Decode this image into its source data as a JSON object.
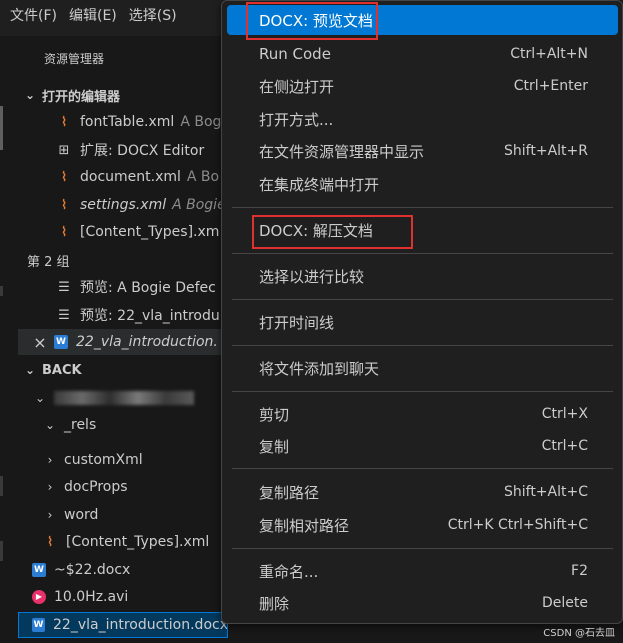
{
  "menubar": {
    "items": [
      "文件(F)",
      "编辑(E)",
      "选择(S)"
    ]
  },
  "sidebar": {
    "title": "资源管理器",
    "open_editors_header": "打开的编辑器",
    "open_editors": [
      {
        "name": "fontTable.xml",
        "desc": "A Bogi",
        "icon": "rss",
        "italic": false
      },
      {
        "name": "扩展: DOCX Editor",
        "desc": "",
        "icon": "ext",
        "italic": false
      },
      {
        "name": "document.xml",
        "desc": "A Bo",
        "icon": "rss",
        "italic": false
      },
      {
        "name": "settings.xml",
        "desc": "A Bogie",
        "icon": "rss",
        "italic": true
      },
      {
        "name": "[Content_Types].xm",
        "desc": "",
        "icon": "rss",
        "italic": false
      }
    ],
    "group2_label": "第 2 组",
    "group2": [
      {
        "name": "预览: A Bogie Defec",
        "icon": "lines"
      },
      {
        "name": "预览: 22_vla_introdu",
        "icon": "lines"
      },
      {
        "name": "22_vla_introduction.",
        "icon": "word",
        "italic": true
      }
    ],
    "folder_header": "BACK",
    "tree": {
      "rels": "_rels",
      "customXml": "customXml",
      "docProps": "docProps",
      "word": "word",
      "content_types": "[Content_Types].xml",
      "tmp_docx": "~$22.docx",
      "video": "10.0Hz.avi",
      "active_docx": "22_vla_introduction.docx"
    }
  },
  "context_menu": {
    "items": [
      {
        "label": "DOCX: 预览文档",
        "shortcut": ""
      },
      {
        "label": "Run Code",
        "shortcut": "Ctrl+Alt+N"
      },
      {
        "label": "在侧边打开",
        "shortcut": "Ctrl+Enter"
      },
      {
        "label": "打开方式...",
        "shortcut": ""
      },
      {
        "label": "在文件资源管理器中显示",
        "shortcut": "Shift+Alt+R"
      },
      {
        "label": "在集成终端中打开",
        "shortcut": ""
      },
      {
        "label": "DOCX: 解压文档",
        "shortcut": ""
      },
      {
        "label": "选择以进行比较",
        "shortcut": ""
      },
      {
        "label": "打开时间线",
        "shortcut": ""
      },
      {
        "label": "将文件添加到聊天",
        "shortcut": ""
      },
      {
        "label": "剪切",
        "shortcut": "Ctrl+X"
      },
      {
        "label": "复制",
        "shortcut": "Ctrl+C"
      },
      {
        "label": "复制路径",
        "shortcut": "Shift+Alt+C"
      },
      {
        "label": "复制相对路径",
        "shortcut": "Ctrl+K Ctrl+Shift+C"
      },
      {
        "label": "重命名...",
        "shortcut": "F2"
      },
      {
        "label": "删除",
        "shortcut": "Delete"
      }
    ]
  },
  "icons": {
    "file_xml": "rss-icon",
    "extension": "extension-icon",
    "preview": "preview-lines-icon",
    "word": "word-file-icon",
    "video": "video-file-icon",
    "close": "close-icon"
  },
  "colors": {
    "menu_highlight": "#0078d4",
    "annotation_box": "#e03131",
    "xml_icon": "#e37933",
    "word_icon": "#2b7cd3"
  },
  "watermark": "CSDN @石去皿"
}
